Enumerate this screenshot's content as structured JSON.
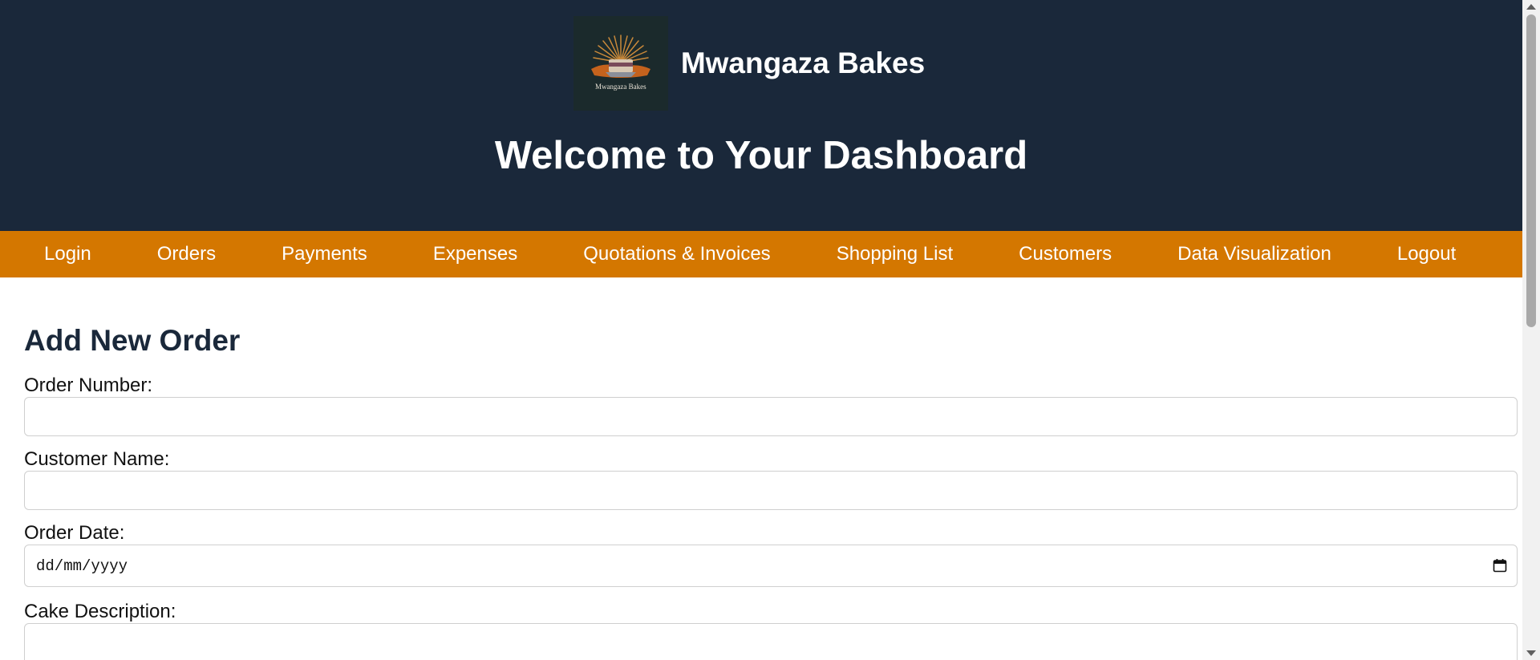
{
  "header": {
    "logo_text": "Mwangaza Bakes",
    "brand_name": "Mwangaza Bakes",
    "welcome": "Welcome to Your Dashboard"
  },
  "nav": {
    "items": [
      {
        "label": "Login"
      },
      {
        "label": "Orders"
      },
      {
        "label": "Payments"
      },
      {
        "label": "Expenses"
      },
      {
        "label": "Quotations & Invoices"
      },
      {
        "label": "Shopping List"
      },
      {
        "label": "Customers"
      },
      {
        "label": "Data Visualization"
      },
      {
        "label": "Logout"
      }
    ]
  },
  "form": {
    "title": "Add New Order",
    "order_number": {
      "label": "Order Number:",
      "value": ""
    },
    "customer_name": {
      "label": "Customer Name:",
      "value": ""
    },
    "order_date": {
      "label": "Order Date:",
      "placeholder": "dd/mm/yyyy"
    },
    "cake_description": {
      "label": "Cake Description:",
      "value": ""
    }
  },
  "colors": {
    "header_bg": "#1a283a",
    "nav_bg": "#d47700",
    "title_color": "#1a283a"
  }
}
